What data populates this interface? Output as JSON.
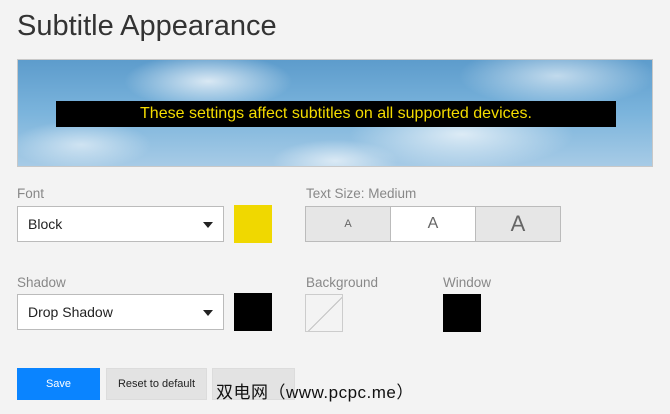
{
  "page": {
    "title": "Subtitle Appearance"
  },
  "preview": {
    "text": "These settings affect subtitles on all supported devices.",
    "text_color": "#f5dc00",
    "bar_color": "#000000"
  },
  "font": {
    "label": "Font",
    "value": "Block",
    "color": "#f0d800"
  },
  "text_size": {
    "label": "Text Size: Medium",
    "options": [
      "A",
      "A",
      "A"
    ],
    "selected_index": 1
  },
  "shadow": {
    "label": "Shadow",
    "value": "Drop Shadow",
    "color": "#000000"
  },
  "background": {
    "label": "Background",
    "state": "none"
  },
  "window": {
    "label": "Window",
    "color": "#000000"
  },
  "actions": {
    "save": "Save",
    "reset": "Reset to default"
  },
  "watermark": "双电网（www.pcpc.me）"
}
